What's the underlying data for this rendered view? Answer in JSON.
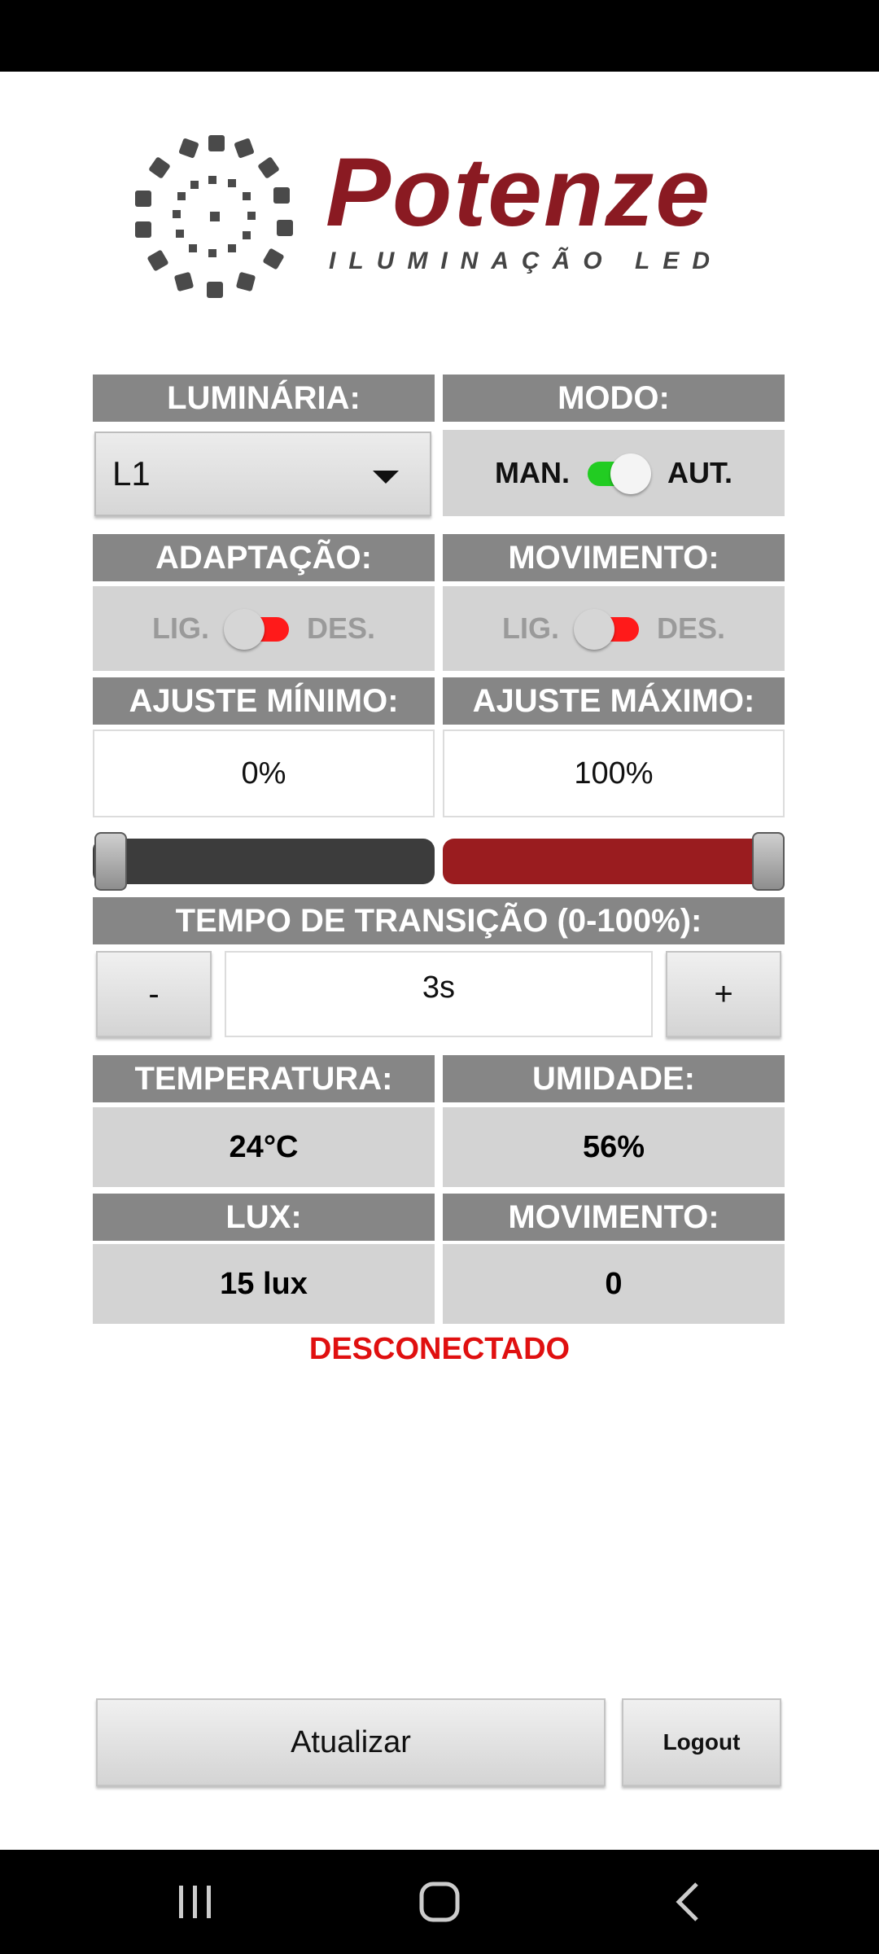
{
  "logo": {
    "brand": "Potenze",
    "tagline": "ILUMINAÇÃO LED",
    "brand_color": "#8a1a22"
  },
  "luminaria": {
    "header": "LUMINÁRIA:",
    "selected": "L1"
  },
  "modo": {
    "header": "MODO:",
    "left_label": "MAN.",
    "right_label": "AUT.",
    "state": "on",
    "active_color": "#22cc22"
  },
  "adaptacao": {
    "header": "ADAPTAÇÃO:",
    "left_label": "LIG.",
    "right_label": "DES.",
    "state": "off",
    "track_color": "#ff1a1a"
  },
  "movimento_toggle": {
    "header": "MOVIMENTO:",
    "left_label": "LIG.",
    "right_label": "DES.",
    "state": "off",
    "track_color": "#ff1a1a"
  },
  "ajuste_minimo": {
    "header": "AJUSTE MÍNIMO:",
    "value": "0%"
  },
  "ajuste_maximo": {
    "header": "AJUSTE MÁXIMO:",
    "value": "100%"
  },
  "range_slider": {
    "min_percent": 0,
    "max_percent": 100,
    "low_color": "#3c3c3c",
    "high_color": "#9a1c1f"
  },
  "transicao": {
    "header": "TEMPO DE TRANSIÇÃO (0-100%):",
    "minus_label": "-",
    "value": "3s",
    "plus_label": "+"
  },
  "sensores": {
    "temperatura": {
      "header": "TEMPERATURA:",
      "value": "24°C"
    },
    "umidade": {
      "header": "UMIDADE:",
      "value": "56%"
    },
    "lux": {
      "header": "LUX:",
      "value": "15 lux"
    },
    "movimento": {
      "header": "MOVIMENTO:",
      "value": "0"
    }
  },
  "connection_status": {
    "text": "DESCONECTADO",
    "color": "#e01010"
  },
  "actions": {
    "refresh_label": "Atualizar",
    "logout_label": "Logout"
  },
  "navigation": {
    "icons": [
      "recent-apps-icon",
      "home-icon",
      "back-icon"
    ]
  }
}
